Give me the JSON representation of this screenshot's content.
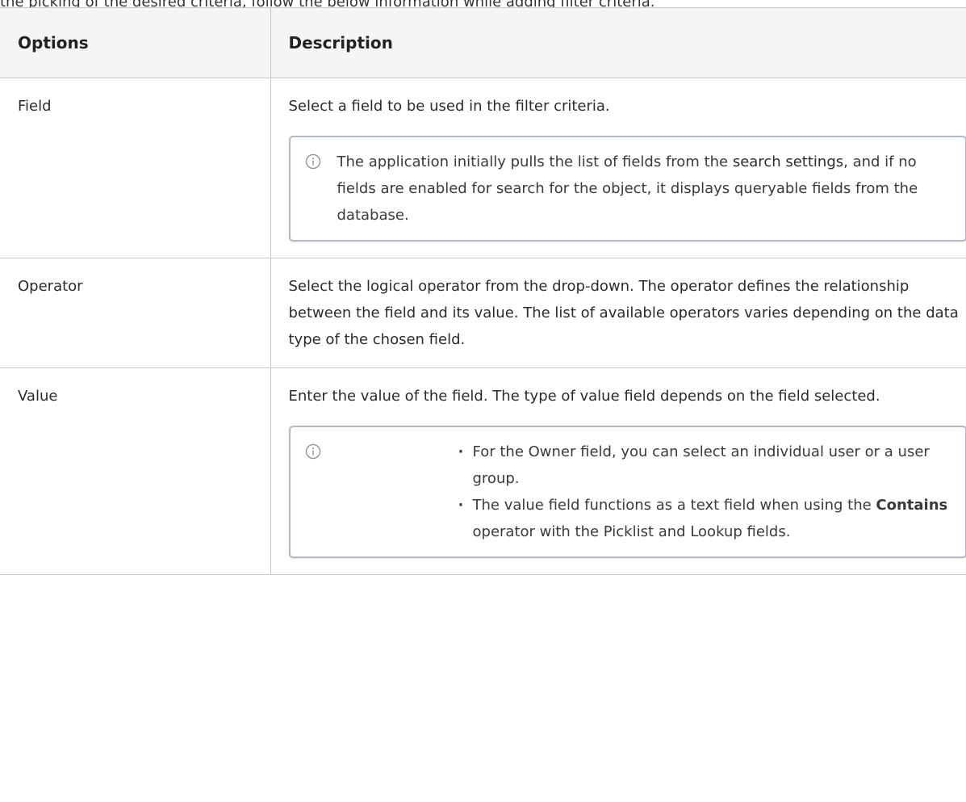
{
  "intro_text": "the picking of the desired criteria, follow the below information while adding filter criteria.",
  "table": {
    "headers": [
      "Options",
      "Description"
    ],
    "rows": [
      {
        "option": "Field",
        "description": "Select a field to be used in the filter criteria.",
        "note": {
          "icon": "info-icon",
          "text_before_link": "The application initially pulls the list of fields from the ",
          "link_text": "search settings",
          "text_after_link": ", and if no fields are enabled for search for the object, it displays queryable fields from the database."
        }
      },
      {
        "option": "Operator",
        "description": "Select the logical operator from the drop-down. The operator defines the relationship between the field and its value. The list of available operators varies depending on the data type of the chosen field."
      },
      {
        "option": "Value",
        "description": "Enter the value of the field. The type of value field depends on the field selected.",
        "note": {
          "icon": "info-icon",
          "bullets": [
            {
              "text": "For the Owner field, you can select an individual user or a user group."
            },
            {
              "before": "The value field functions as a text field when using the ",
              "bold": "Contains",
              "after": " operator with the Picklist and Lookup fields."
            }
          ]
        }
      }
    ]
  }
}
